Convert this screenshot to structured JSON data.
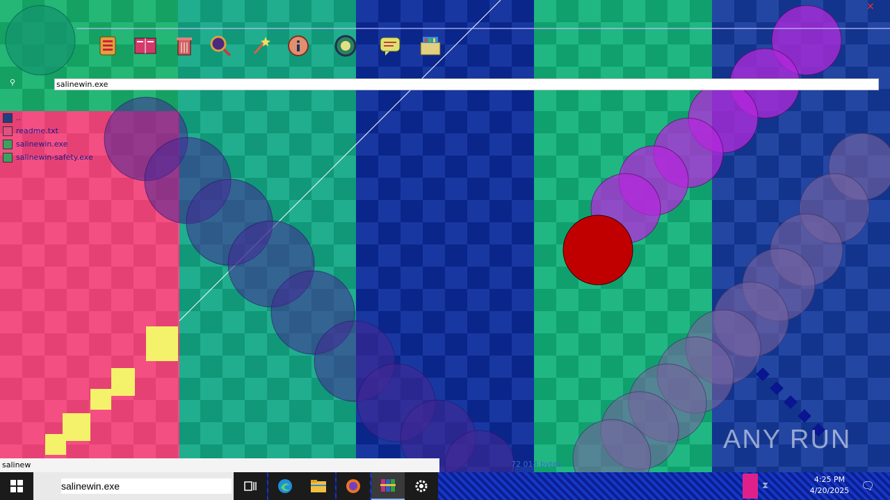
{
  "toolbar": {
    "icons": [
      "notebook-icon",
      "book-icon",
      "trash-icon",
      "magnifier-icon",
      "wand-icon",
      "info-icon",
      "shield-icon",
      "chat-icon",
      "toolbox-icon"
    ]
  },
  "address_bar": {
    "value": "salinewin.exe"
  },
  "files": [
    {
      "name": "..",
      "icon": "folder-up-icon"
    },
    {
      "name": "readme.txt",
      "icon": "text-file-icon"
    },
    {
      "name": "salinewin.exe",
      "icon": "exe-file-icon"
    },
    {
      "name": "salinewin-safety.exe",
      "icon": "exe-file-icon"
    }
  ],
  "status": {
    "left": "salinew",
    "right": "72 014 bytes"
  },
  "taskbar": {
    "search_value": "salinewin.exe",
    "clock_time": "4:25 PM",
    "clock_date": "4/20/2025"
  },
  "watermark": "ANY RUN",
  "colors": {
    "pink": "#f2447a",
    "red": "#c00000",
    "taskbar": "#1637c8",
    "yellow": "#f4f26a"
  }
}
